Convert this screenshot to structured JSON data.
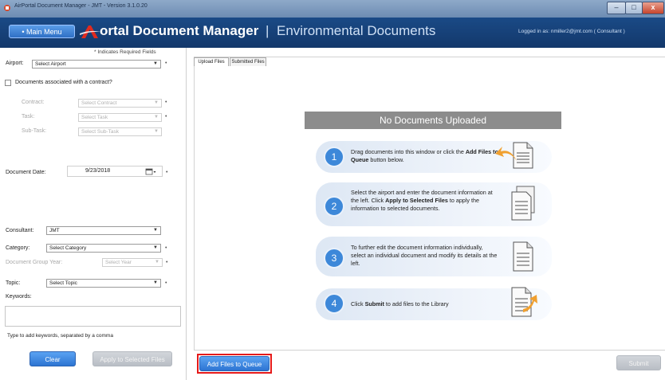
{
  "window": {
    "title": "AirPortal Document Manager - JMT - Version 3.1.0.20",
    "minimize": "–",
    "maximize": "□",
    "close": "x"
  },
  "header": {
    "main_menu": "• Main Menu",
    "app_title": "ortal Document Manager",
    "separator": "|",
    "section": "Environmental Documents",
    "login_info": "Logged in as: nmiller2@jmt.com ( Consultant )"
  },
  "form": {
    "required_note": "* Indicates Required Fields",
    "airport_label": "Airport:",
    "airport_value": "Select Airport",
    "contract_checkbox_label": "Documents associated with a contract?",
    "contract_label": "Contract:",
    "contract_value": "Select Contract",
    "task_label": "Task:",
    "task_value": "Select Task",
    "subtask_label": "Sub-Task:",
    "subtask_value": "Select Sub-Task",
    "document_date_label": "Document Date:",
    "document_date_value": "9/23/2018",
    "consultant_label": "Consultant:",
    "consultant_value": "JMT",
    "category_label": "Category:",
    "category_value": "Select Category",
    "doc_group_year_label": "Document Group Year:",
    "doc_group_year_value": "Select Year",
    "topic_label": "Topic:",
    "topic_value": "Select Topic",
    "keywords_label": "Keywords:",
    "keywords_hint": "Type to add keywords, separated by a comma",
    "clear_button": "Clear",
    "apply_button": "Apply to Selected Files",
    "required_mark": "•",
    "dropdown_arrow": "▼"
  },
  "tabs": [
    {
      "label": "Upload Files"
    },
    {
      "label": "Submitted Files"
    }
  ],
  "upload": {
    "empty_title": "No Documents Uploaded",
    "steps": [
      {
        "num": "1",
        "text_a": "Drag documents into this window or click the ",
        "bold": "Add Files to Queue",
        "text_b": " button below."
      },
      {
        "num": "2",
        "text_a": "Select the airport and enter the document information at the left. Click ",
        "bold": "Apply to Selected Files",
        "text_b": " to apply the information to selected documents."
      },
      {
        "num": "3",
        "text_a": "To further edit the document information individually, select an individual document and modify its details at the left.",
        "bold": "",
        "text_b": ""
      },
      {
        "num": "4",
        "text_a": "Click ",
        "bold": "Submit",
        "text_b": " to add files to the Library"
      }
    ],
    "add_files_button": "Add Files to Queue",
    "submit_button": "Submit"
  },
  "colors": {
    "header_bg": "#1a4a86",
    "accent_blue": "#3d88d9",
    "highlight_red": "#e51a1a",
    "logo_red": "#e22a1e",
    "arrow_orange": "#f0a030"
  }
}
